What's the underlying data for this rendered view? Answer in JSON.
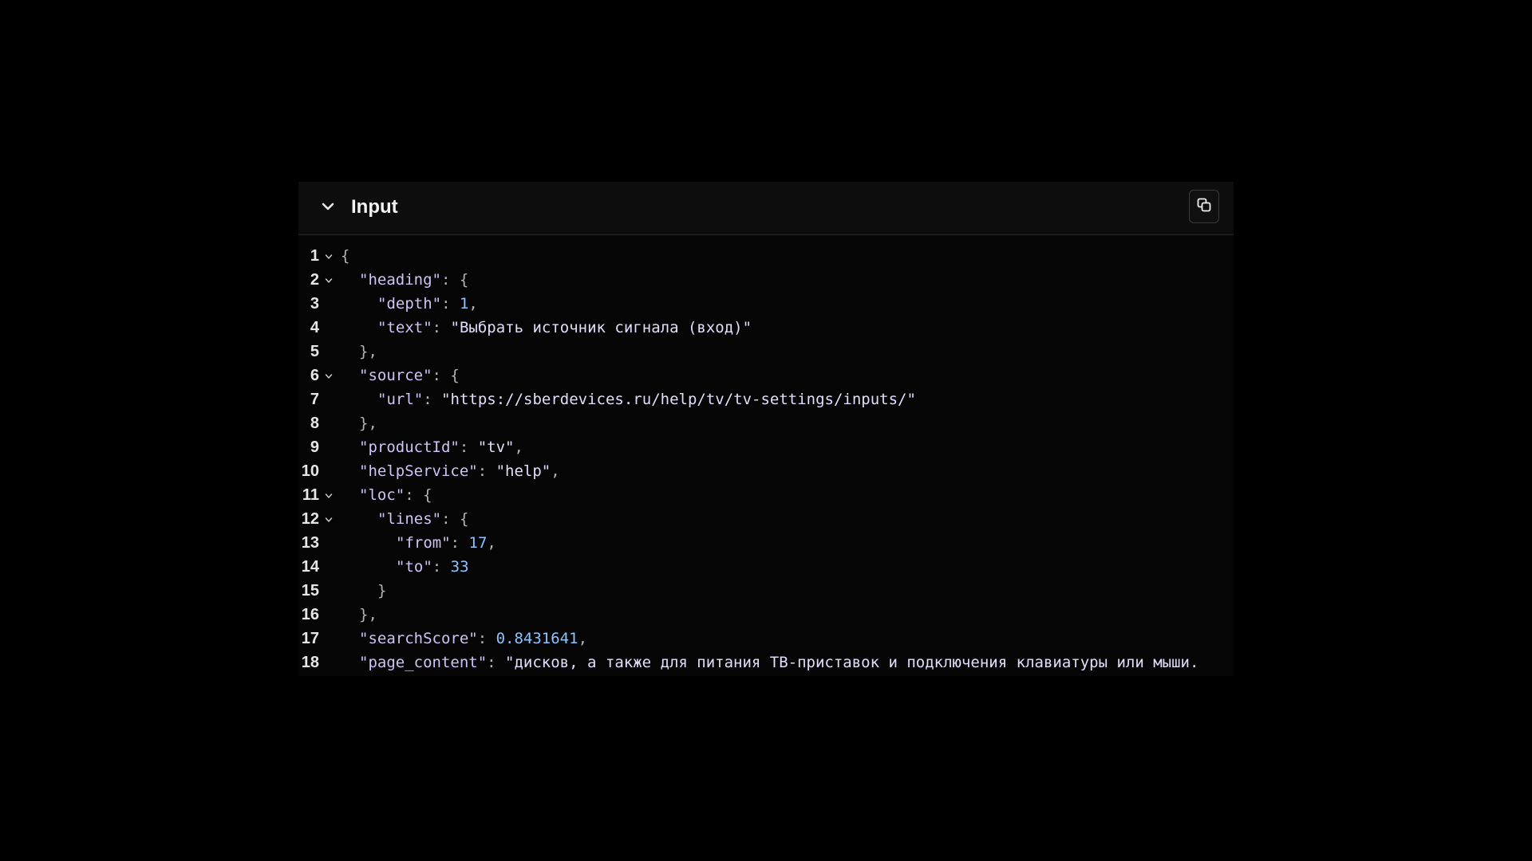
{
  "panel": {
    "title": "Input",
    "collapse_icon": "chevron-down-icon",
    "copy_icon": "copy-icon"
  },
  "colors": {
    "background": "#000000",
    "key": "#d3c2f7",
    "string": "#e4dcfb",
    "number": "#8fc3ff",
    "punctuation": "#b4b4b4"
  },
  "code": {
    "lines": [
      {
        "num": "1",
        "fold": true,
        "indent": 0,
        "tokens": [
          {
            "t": "{",
            "c": "punc"
          }
        ]
      },
      {
        "num": "2",
        "fold": true,
        "indent": 1,
        "tokens": [
          {
            "t": "\"heading\"",
            "c": "key"
          },
          {
            "t": ": {",
            "c": "punc"
          }
        ]
      },
      {
        "num": "3",
        "fold": false,
        "indent": 2,
        "tokens": [
          {
            "t": "\"depth\"",
            "c": "key"
          },
          {
            "t": ": ",
            "c": "punc"
          },
          {
            "t": "1",
            "c": "num"
          },
          {
            "t": ",",
            "c": "punc"
          }
        ]
      },
      {
        "num": "4",
        "fold": false,
        "indent": 2,
        "tokens": [
          {
            "t": "\"text\"",
            "c": "key"
          },
          {
            "t": ": ",
            "c": "punc"
          },
          {
            "t": "\"Выбрать источник сигнала (вход)\"",
            "c": "str"
          }
        ]
      },
      {
        "num": "5",
        "fold": false,
        "indent": 1,
        "tokens": [
          {
            "t": "},",
            "c": "punc"
          }
        ]
      },
      {
        "num": "6",
        "fold": true,
        "indent": 1,
        "tokens": [
          {
            "t": "\"source\"",
            "c": "key"
          },
          {
            "t": ": {",
            "c": "punc"
          }
        ]
      },
      {
        "num": "7",
        "fold": false,
        "indent": 2,
        "tokens": [
          {
            "t": "\"url\"",
            "c": "key"
          },
          {
            "t": ": ",
            "c": "punc"
          },
          {
            "t": "\"https://sberdevices.ru/help/tv/tv-settings/inputs/\"",
            "c": "str"
          }
        ]
      },
      {
        "num": "8",
        "fold": false,
        "indent": 1,
        "tokens": [
          {
            "t": "},",
            "c": "punc"
          }
        ]
      },
      {
        "num": "9",
        "fold": false,
        "indent": 1,
        "tokens": [
          {
            "t": "\"productId\"",
            "c": "key"
          },
          {
            "t": ": ",
            "c": "punc"
          },
          {
            "t": "\"tv\"",
            "c": "str"
          },
          {
            "t": ",",
            "c": "punc"
          }
        ]
      },
      {
        "num": "10",
        "fold": false,
        "indent": 1,
        "tokens": [
          {
            "t": "\"helpService\"",
            "c": "key"
          },
          {
            "t": ": ",
            "c": "punc"
          },
          {
            "t": "\"help\"",
            "c": "str"
          },
          {
            "t": ",",
            "c": "punc"
          }
        ]
      },
      {
        "num": "11",
        "fold": true,
        "indent": 1,
        "tokens": [
          {
            "t": "\"loc\"",
            "c": "key"
          },
          {
            "t": ": {",
            "c": "punc"
          }
        ]
      },
      {
        "num": "12",
        "fold": true,
        "indent": 2,
        "tokens": [
          {
            "t": "\"lines\"",
            "c": "key"
          },
          {
            "t": ": {",
            "c": "punc"
          }
        ]
      },
      {
        "num": "13",
        "fold": false,
        "indent": 3,
        "tokens": [
          {
            "t": "\"from\"",
            "c": "key"
          },
          {
            "t": ": ",
            "c": "punc"
          },
          {
            "t": "17",
            "c": "num"
          },
          {
            "t": ",",
            "c": "punc"
          }
        ]
      },
      {
        "num": "14",
        "fold": false,
        "indent": 3,
        "tokens": [
          {
            "t": "\"to\"",
            "c": "key"
          },
          {
            "t": ": ",
            "c": "punc"
          },
          {
            "t": "33",
            "c": "num"
          }
        ]
      },
      {
        "num": "15",
        "fold": false,
        "indent": 2,
        "tokens": [
          {
            "t": "}",
            "c": "punc"
          }
        ]
      },
      {
        "num": "16",
        "fold": false,
        "indent": 1,
        "tokens": [
          {
            "t": "},",
            "c": "punc"
          }
        ]
      },
      {
        "num": "17",
        "fold": false,
        "indent": 1,
        "tokens": [
          {
            "t": "\"searchScore\"",
            "c": "key"
          },
          {
            "t": ": ",
            "c": "punc"
          },
          {
            "t": "0.8431641",
            "c": "num"
          },
          {
            "t": ",",
            "c": "punc"
          }
        ]
      },
      {
        "num": "18",
        "fold": false,
        "indent": 1,
        "tokens": [
          {
            "t": "\"page_content\"",
            "c": "key"
          },
          {
            "t": ": ",
            "c": "punc"
          },
          {
            "t": "\"дисков, а также для питания ТВ-приставок и подключения клавиатуры или мыши.",
            "c": "str"
          }
        ]
      }
    ]
  }
}
